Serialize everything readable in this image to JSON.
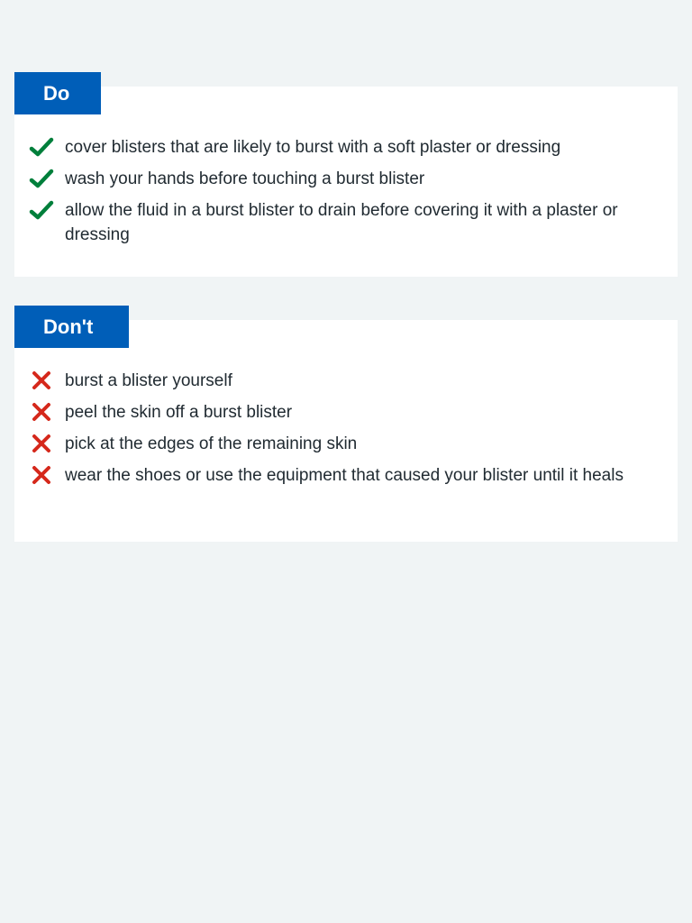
{
  "do_section": {
    "heading": "Do",
    "items": [
      {
        "text": "cover blisters that are likely to burst with a soft plaster or dressing"
      },
      {
        "text": "wash your hands before touching a burst blister"
      },
      {
        "text": "allow the fluid in a burst blister to drain before covering it with a plaster or dressing"
      }
    ],
    "icon": "tick-icon",
    "icon_color": "#007f3b"
  },
  "dont_section": {
    "heading": "Don't",
    "items": [
      {
        "text": "burst a blister yourself"
      },
      {
        "text": "peel the skin off a burst blister"
      },
      {
        "text": "pick at the edges of the remaining skin"
      },
      {
        "text": "wear the shoes or use the equipment that caused your blister until it heals"
      }
    ],
    "icon": "cross-icon",
    "icon_color": "#d5281b"
  },
  "colors": {
    "background": "#f0f4f5",
    "heading_background": "#005eb8",
    "card_background": "#ffffff",
    "text": "#212b32"
  }
}
